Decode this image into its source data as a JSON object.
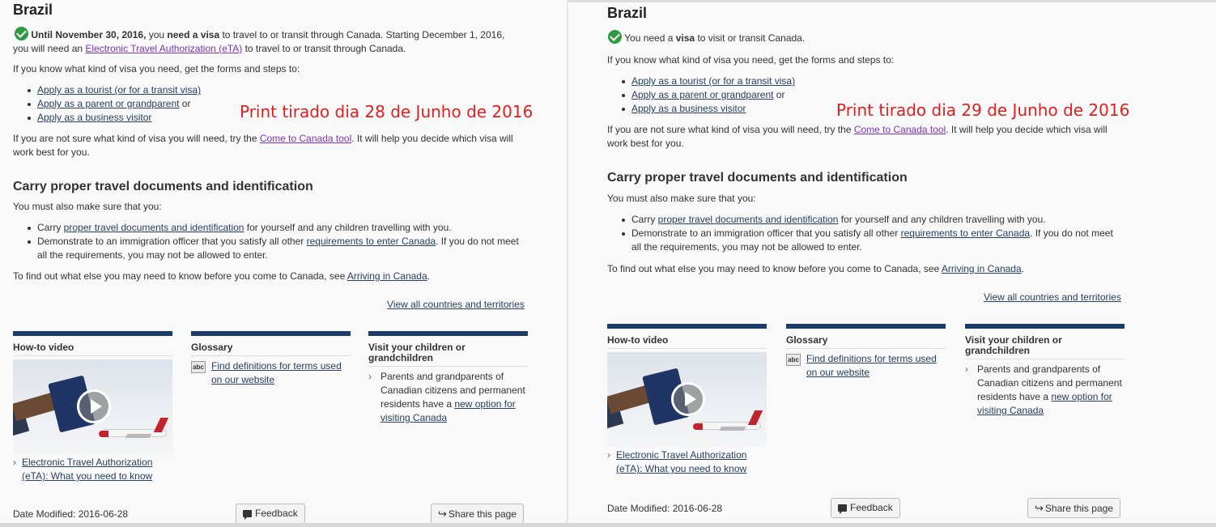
{
  "left": {
    "country": "Brazil",
    "visa_line1_bold": "Until November 30, 2016,",
    "visa_line1_a": " you ",
    "visa_line1_bold2": "need a visa",
    "visa_line1_b": " to travel to or transit through Canada. Starting December 1, 2016,",
    "visa_line2_a": "you will need an ",
    "visa_line2_link": "Electronic Travel Authorization (eTA)",
    "visa_line2_b": " to travel to or transit through Canada.",
    "forms_intro": "If you know what kind of visa you need, get the forms and steps to:",
    "apply_tourist": "Apply as a tourist (or for a transit visa)",
    "apply_parent": "Apply as a parent or grandparent",
    "or": " or",
    "apply_business": "Apply as a business visitor",
    "unsure_a": "If you are not sure what kind of visa you will need, try the ",
    "unsure_link": "Come to Canada tool",
    "unsure_b": ". It will help you decide which visa will",
    "unsure_c": "work best for you.",
    "section_title": "Carry proper travel documents and identification",
    "make_sure": "You must also make sure that you:",
    "carry_a": "Carry ",
    "carry_link": "proper travel documents and identification",
    "carry_b": " for yourself and any children travelling with you.",
    "demo_a": "Demonstrate to an immigration officer that you satisfy all other ",
    "demo_link": "requirements to enter Canada",
    "demo_b": ". If you do not meet",
    "demo_c": "all the requirements, you may not be allowed to enter.",
    "find_out_a": "To find out what else you may need to know before you come to Canada, see ",
    "find_out_link": "Arriving in Canada",
    "find_out_b": ".",
    "view_all": "View all countries and territories",
    "card_video_title": "How-to video",
    "video_link": "Electronic Travel Authorization (eTA): What you need to know",
    "card_glossary_title": "Glossary",
    "glossary_link": "Find definitions for terms used on our website",
    "card_visit_title": "Visit your children or grandchildren",
    "visit_text": "Parents and grandparents of Canadian citizens and permanent residents have a ",
    "visit_link": "new option for visiting Canada",
    "date_modified": "Date Modified: 2016-06-28",
    "feedback": "Feedback",
    "share": "Share this page"
  },
  "right": {
    "country": "Brazil",
    "visa_a": "You need a ",
    "visa_bold": "visa",
    "visa_b": " to visit or transit Canada.",
    "forms_intro": "If you know what kind of visa you need, get the forms and steps to:",
    "apply_tourist": "Apply as a tourist (or for a transit visa)",
    "apply_parent": "Apply as a parent or grandparent",
    "or": " or",
    "apply_business": "Apply as a business visitor",
    "unsure_a": "If you are not sure what kind of visa you will need, try the ",
    "unsure_link": "Come to Canada tool",
    "unsure_b": ". It will help you decide which visa will",
    "unsure_c": "work best for you.",
    "section_title": "Carry proper travel documents and identification",
    "make_sure": "You must also make sure that you:",
    "carry_a": "Carry ",
    "carry_link": "proper travel documents and identification",
    "carry_b": " for yourself and any children travelling with you.",
    "demo_a": "Demonstrate to an immigration officer that you satisfy all other ",
    "demo_link": "requirements to enter Canada",
    "demo_b": ". If you do not meet",
    "demo_c": "all the requirements, you may not be allowed to enter.",
    "find_out_a": "To find out what else you may need to know before you come to Canada, see ",
    "find_out_link": "Arriving in Canada",
    "find_out_b": ".",
    "view_all": "View all countries and territories",
    "card_video_title": "How-to video",
    "video_link": "Electronic Travel Authorization (eTA): What you need to know",
    "card_glossary_title": "Glossary",
    "glossary_link": "Find definitions for terms used on our website",
    "card_visit_title": "Visit your children or grandchildren",
    "visit_text": "Parents and grandparents of Canadian citizens and permanent residents have a ",
    "visit_link": "new option for visiting Canada",
    "date_modified": "Date Modified: 2016-06-28",
    "feedback": "Feedback",
    "share": "Share this page"
  },
  "annotations": {
    "left": "Print tirado dia 28 de Junho de 2016",
    "right": "Print tirado dia 29 de Junho de 2016"
  },
  "colors": {
    "check_green": "#2f9a44",
    "card_bar": "#1c3c6a",
    "annotation_red": "#e31e1e",
    "link": "#284162",
    "visited_link": "#7834bc"
  },
  "icons": [
    "check-circle-icon",
    "abc-dictionary-icon",
    "play-icon",
    "chevron-right-icon",
    "comment-icon",
    "share-icon"
  ]
}
